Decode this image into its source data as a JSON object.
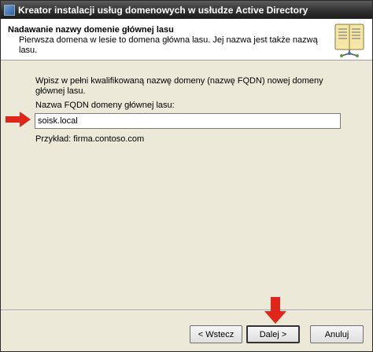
{
  "window": {
    "title": "Kreator instalacji usług domenowych w usłudze Active Directory"
  },
  "header": {
    "title": "Nadawanie nazwy domenie głównej lasu",
    "description": "Pierwsza domena w lesie to domena główna lasu. Jej nazwa jest także nazwą lasu."
  },
  "content": {
    "instruction": "Wpisz w pełni kwalifikowaną nazwę domeny (nazwę FQDN) nowej domeny głównej lasu.",
    "fqdn_label": "Nazwa FQDN domeny głównej lasu:",
    "fqdn_value": "soisk.local",
    "example": "Przykład: firma.contoso.com"
  },
  "buttons": {
    "back": "< Wstecz",
    "next": "Dalej >",
    "cancel": "Anuluj"
  },
  "colors": {
    "annotation_arrow": "#e0261b",
    "header_bg": "#ffffff",
    "dialog_bg": "#ece9d8"
  },
  "icons": [
    "wizard-window-icon",
    "book-icon",
    "red-arrow-right-icon",
    "red-arrow-down-icon"
  ]
}
